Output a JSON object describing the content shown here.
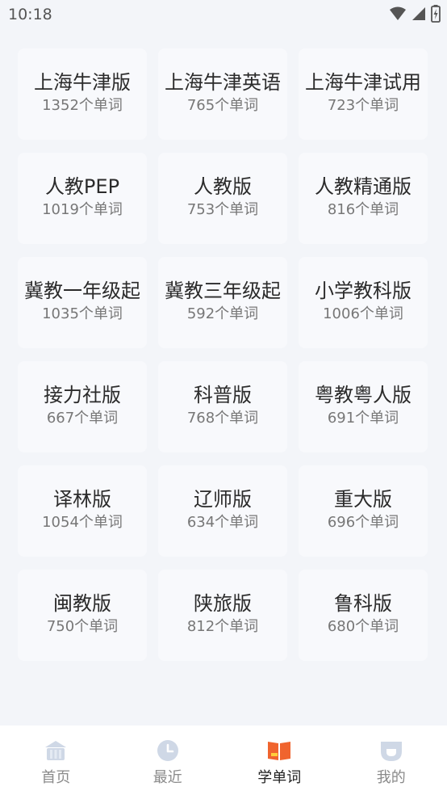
{
  "status_bar": {
    "time": "10:18",
    "icons": [
      "wifi-icon",
      "signal-icon",
      "battery-charging-icon"
    ]
  },
  "textbooks": [
    {
      "title": "上海牛津版",
      "count": "1352个单词"
    },
    {
      "title": "上海牛津英语",
      "count": "765个单词"
    },
    {
      "title": "上海牛津试用",
      "count": "723个单词"
    },
    {
      "title": "人教PEP",
      "count": "1019个单词"
    },
    {
      "title": "人教版",
      "count": "753个单词"
    },
    {
      "title": "人教精通版",
      "count": "816个单词"
    },
    {
      "title": "冀教一年级起",
      "count": "1035个单词"
    },
    {
      "title": "冀教三年级起",
      "count": "592个单词"
    },
    {
      "title": "小学教科版",
      "count": "1006个单词"
    },
    {
      "title": "接力社版",
      "count": "667个单词"
    },
    {
      "title": "科普版",
      "count": "768个单词"
    },
    {
      "title": "粤教粤人版",
      "count": "691个单词"
    },
    {
      "title": "译林版",
      "count": "1054个单词"
    },
    {
      "title": "辽师版",
      "count": "634个单词"
    },
    {
      "title": "重大版",
      "count": "696个单词"
    },
    {
      "title": "闽教版",
      "count": "750个单词"
    },
    {
      "title": "陕旅版",
      "count": "812个单词"
    },
    {
      "title": "鲁科版",
      "count": "680个单词"
    }
  ],
  "bottom_nav": {
    "items": [
      {
        "label": "首页",
        "icon": "home-icon",
        "active": false
      },
      {
        "label": "最近",
        "icon": "clock-icon",
        "active": false
      },
      {
        "label": "学单词",
        "icon": "book-icon",
        "active": true
      },
      {
        "label": "我的",
        "icon": "profile-icon",
        "active": false
      }
    ]
  },
  "colors": {
    "background": "#f3f5f9",
    "card": "#f8f9fc",
    "nav_inactive_icon": "#cfd8e6",
    "nav_active_icon": "#f0642e"
  }
}
